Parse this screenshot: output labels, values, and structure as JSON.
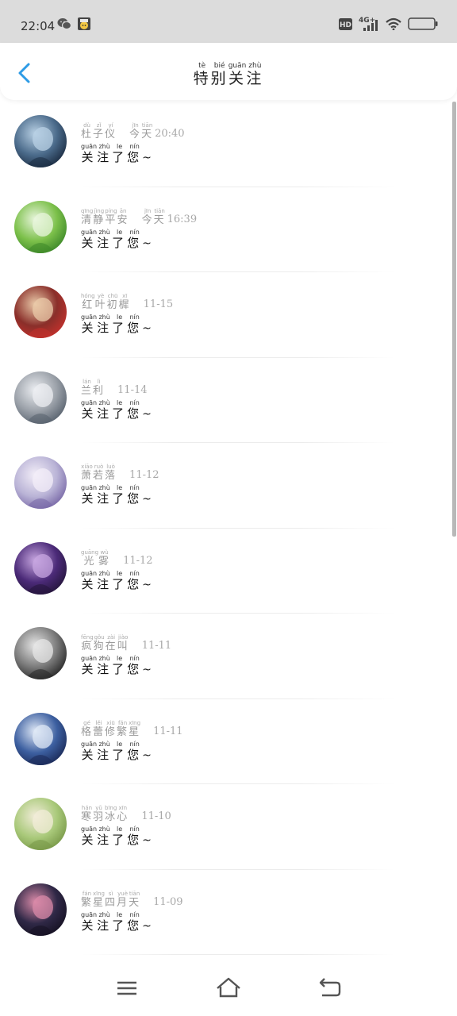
{
  "status_bar": {
    "time": "22:04",
    "left_icons": [
      "wechat-icon",
      "app-icon"
    ],
    "right_icons": [
      "hd-icon",
      "4g-signal-icon",
      "wifi-icon",
      "battery-icon"
    ],
    "hd_label": "HD",
    "network_label": "4G+"
  },
  "header": {
    "title_chars": [
      {
        "c": "特",
        "p": "tè"
      },
      {
        "c": "别",
        "p": "bié"
      },
      {
        "c": "关",
        "p": "guān"
      },
      {
        "c": "注",
        "p": "zhù"
      }
    ],
    "back_icon": "chevron-left-icon",
    "accent": "#2d9be6"
  },
  "message_chars": [
    {
      "c": "关",
      "p": "guān"
    },
    {
      "c": "注",
      "p": "zhù"
    },
    {
      "c": "了",
      "p": "le"
    },
    {
      "c": "您",
      "p": "nín"
    }
  ],
  "message_suffix": "~",
  "items": [
    {
      "name": [
        {
          "c": "杜",
          "p": "dù"
        },
        {
          "c": "子",
          "p": "zǐ"
        },
        {
          "c": "仪",
          "p": "yí"
        }
      ],
      "time_chars": [
        {
          "c": "今",
          "p": "jīn"
        },
        {
          "c": "天",
          "p": "tiān"
        }
      ],
      "time": "20:40",
      "avatar": [
        "#4a6a8a",
        "#b8d0e4",
        "#1d2e44"
      ]
    },
    {
      "name": [
        {
          "c": "清",
          "p": "qīng"
        },
        {
          "c": "静",
          "p": "jìng"
        },
        {
          "c": "平",
          "p": "píng"
        },
        {
          "c": "安",
          "p": "ān"
        }
      ],
      "time_chars": [
        {
          "c": "今",
          "p": "jīn"
        },
        {
          "c": "天",
          "p": "tiān"
        }
      ],
      "time": "16:39",
      "avatar": [
        "#7cc04a",
        "#e8f5dc",
        "#3f8a2a"
      ]
    },
    {
      "name": [
        {
          "c": "红",
          "p": "hóng"
        },
        {
          "c": "叶",
          "p": "yè"
        },
        {
          "c": "初",
          "p": "chū"
        },
        {
          "c": "樨",
          "p": "xī"
        }
      ],
      "time_chars": [],
      "time": "11-15",
      "avatar": [
        "#8a2f2a",
        "#e9c9a8",
        "#c0302c"
      ]
    },
    {
      "name": [
        {
          "c": "兰",
          "p": "lán"
        },
        {
          "c": "利",
          "p": "lì"
        }
      ],
      "time_chars": [],
      "time": "11-14",
      "avatar": [
        "#9aa0a8",
        "#eceef2",
        "#5a6470"
      ]
    },
    {
      "name": [
        {
          "c": "萧",
          "p": "xiāo"
        },
        {
          "c": "若",
          "p": "ruò"
        },
        {
          "c": "落",
          "p": "luò"
        }
      ],
      "time_chars": [],
      "time": "11-12",
      "avatar": [
        "#b9b3d6",
        "#f3eef8",
        "#7a6aa8"
      ]
    },
    {
      "name": [
        {
          "c": "光",
          "p": "guāng"
        },
        {
          "c": "雾",
          "p": "wù"
        }
      ],
      "time_chars": [],
      "time": "11-12",
      "avatar": [
        "#4b2a78",
        "#c7a6e0",
        "#26163e"
      ]
    },
    {
      "name": [
        {
          "c": "疯",
          "p": "fēng"
        },
        {
          "c": "狗",
          "p": "gǒu"
        },
        {
          "c": "在",
          "p": "zài"
        },
        {
          "c": "叫",
          "p": "jiào"
        }
      ],
      "time_chars": [],
      "time": "11-11",
      "avatar": [
        "#7a7a7a",
        "#e6e6e6",
        "#2a2a2a"
      ]
    },
    {
      "name": [
        {
          "c": "格",
          "p": "gé"
        },
        {
          "c": "蕾",
          "p": "lěi"
        },
        {
          "c": "修",
          "p": "xiū"
        },
        {
          "c": "繁",
          "p": "fán"
        },
        {
          "c": "星",
          "p": "xīng"
        }
      ],
      "time_chars": [],
      "time": "11-11",
      "avatar": [
        "#3c5fa0",
        "#dfe8f6",
        "#1c2c5a"
      ]
    },
    {
      "name": [
        {
          "c": "寒",
          "p": "hán"
        },
        {
          "c": "羽",
          "p": "yǔ"
        },
        {
          "c": "冰",
          "p": "bīng"
        },
        {
          "c": "心",
          "p": "xīn"
        }
      ],
      "time_chars": [],
      "time": "11-10",
      "avatar": [
        "#a9c97a",
        "#f1ecd8",
        "#7a9a4a"
      ]
    },
    {
      "name": [
        {
          "c": "繁",
          "p": "fán"
        },
        {
          "c": "星",
          "p": "xīng"
        },
        {
          "c": "四",
          "p": "sì"
        },
        {
          "c": "月",
          "p": "yuè"
        },
        {
          "c": "天",
          "p": "tiān"
        }
      ],
      "time_chars": [],
      "time": "11-09",
      "avatar": [
        "#2f2846",
        "#d98aa8",
        "#171224"
      ]
    }
  ],
  "nav_bar": {
    "icons": [
      "menu-icon",
      "home-icon",
      "back-nav-icon"
    ]
  }
}
